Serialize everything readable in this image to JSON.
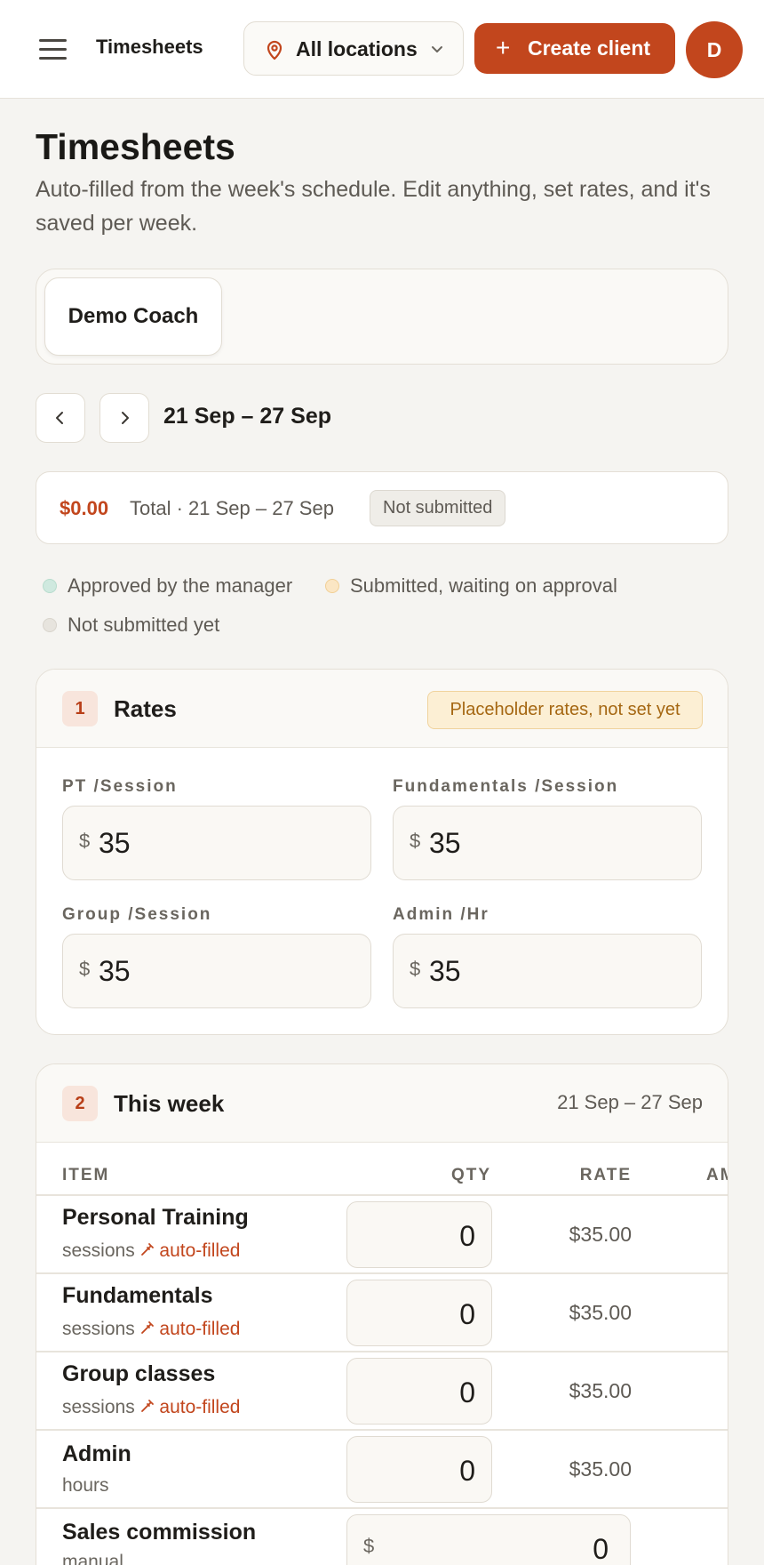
{
  "topbar": {
    "app_title": "Timesheets",
    "location_label": "All locations",
    "create_label": "Create client",
    "create_icon": "+",
    "avatar_initial": "D"
  },
  "header": {
    "title": "Timesheets",
    "subtitle": "Auto-filled from the week's schedule. Edit anything, set rates, and it's saved per week."
  },
  "coaches": [
    "Demo Coach"
  ],
  "week": {
    "range": "21 Sep – 27 Sep"
  },
  "summary": {
    "amount": "$0.00",
    "total_text": "Total · 21 Sep – 27 Sep",
    "status": "Not submitted"
  },
  "legend": {
    "approved": "Approved by the manager",
    "submitted": "Submitted, waiting on approval",
    "not_submitted": "Not submitted yet"
  },
  "colors": {
    "accent": "#c2461d",
    "approved": "#cfe9df",
    "submitted": "#fbe6c4",
    "not_submitted": "#e7e4de"
  },
  "rates": {
    "step": "1",
    "title": "Rates",
    "warning": "Placeholder rates, not set yet",
    "currency": "$",
    "fields": [
      {
        "label": "PT /Session",
        "value": "35"
      },
      {
        "label": "Fundamentals /Session",
        "value": "35"
      },
      {
        "label": "Group /Session",
        "value": "35"
      },
      {
        "label": "Admin /Hr",
        "value": "35"
      }
    ]
  },
  "this_week": {
    "step": "2",
    "title": "This week",
    "range": "21 Sep – 27 Sep",
    "columns": [
      "ITEM",
      "QTY",
      "RATE",
      "AM"
    ],
    "auto_tag": "auto-filled",
    "rows": [
      {
        "title": "Personal Training",
        "unit": "sessions",
        "qty": "0",
        "rate": "$35.00"
      },
      {
        "title": "Fundamentals",
        "unit": "sessions",
        "qty": "0",
        "rate": "$35.00"
      },
      {
        "title": "Group classes",
        "unit": "sessions",
        "qty": "0",
        "rate": "$35.00"
      },
      {
        "title": "Admin",
        "unit": "hours",
        "qty": "0",
        "rate": "$35.00"
      }
    ],
    "commission": {
      "title": "Sales commission",
      "unit": "manual",
      "currency": "$",
      "value": "0"
    }
  }
}
